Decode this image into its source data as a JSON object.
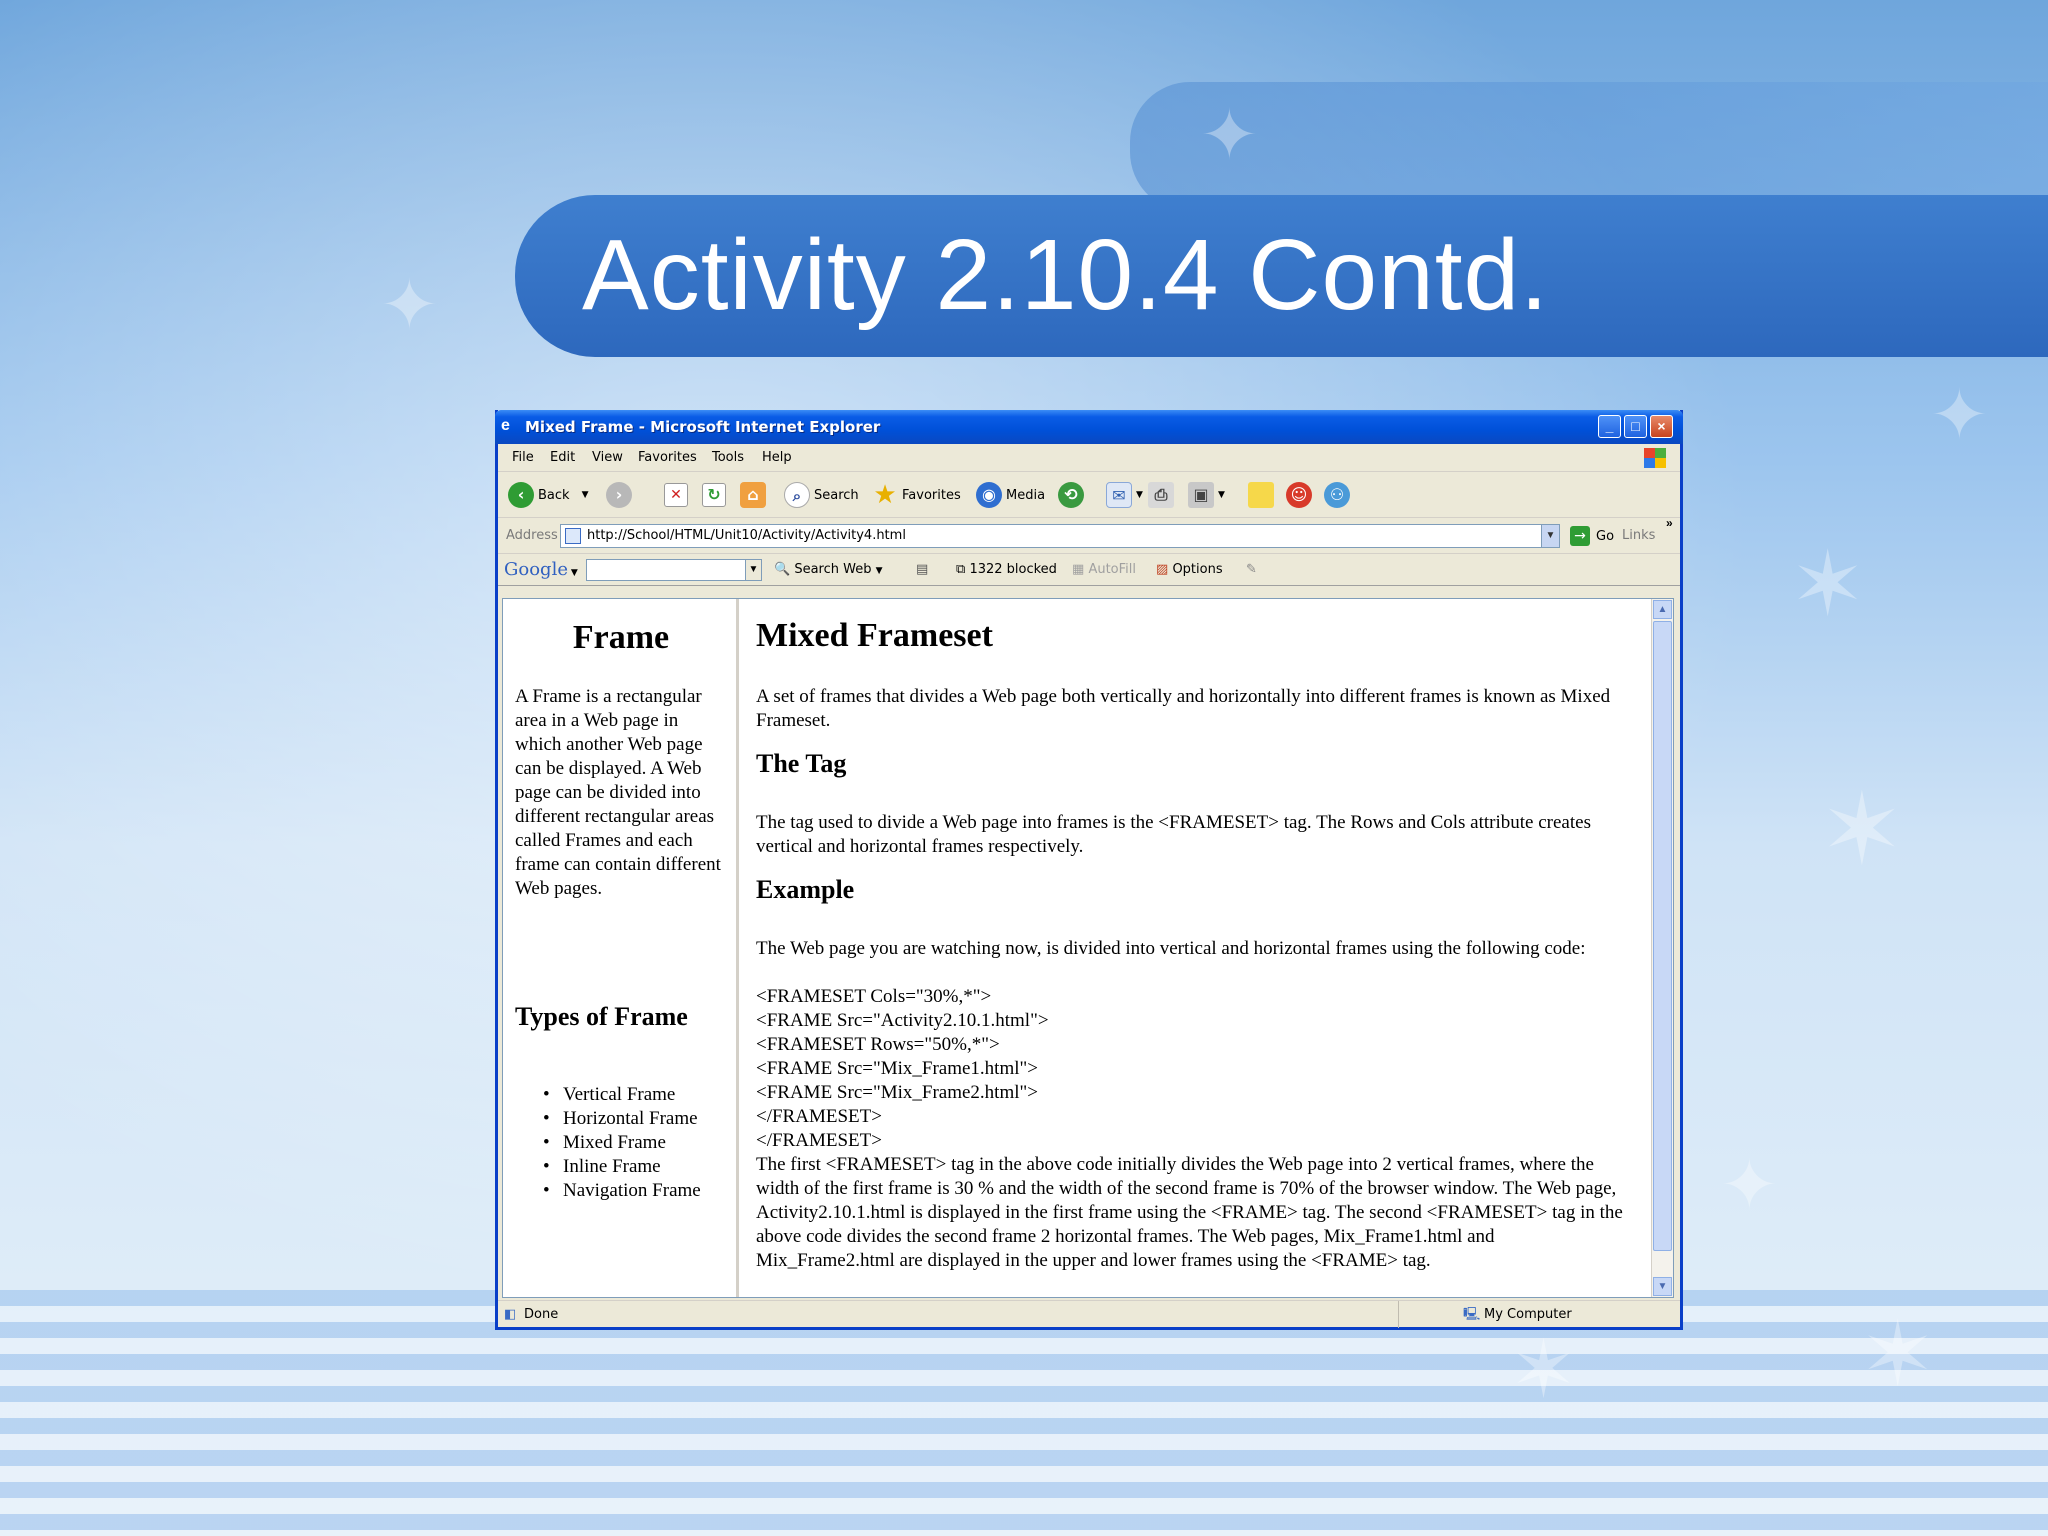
{
  "slide": {
    "title": "Activity 2.10.4 Contd."
  },
  "window": {
    "title": "Mixed Frame - Microsoft Internet Explorer",
    "controls": {
      "minimize": "_",
      "maximize": "□",
      "close": "×"
    }
  },
  "menu": [
    "File",
    "Edit",
    "View",
    "Favorites",
    "Tools",
    "Help"
  ],
  "toolbar": {
    "back": "Back",
    "search": "Search",
    "favorites": "Favorites",
    "media": "Media"
  },
  "address": {
    "label": "Address",
    "url": "http://School/HTML/Unit10/Activity/Activity4.html",
    "go": "Go",
    "links": "Links"
  },
  "google_bar": {
    "logo": "Google",
    "search_web": "Search Web",
    "blocked": "1322 blocked",
    "autofill": "AutoFill",
    "options": "Options"
  },
  "left_frame": {
    "heading": "Frame",
    "paragraph": "A Frame is a rectangular area in a Web page in which another Web page can be displayed. A Web page can be divided into different rectangular areas called Frames and each frame can contain different Web pages.",
    "types_heading": "Types of Frame",
    "types": [
      "Vertical Frame",
      "Horizontal Frame",
      "Mixed Frame",
      "Inline Frame",
      "Navigation Frame"
    ]
  },
  "right_frame": {
    "heading": "Mixed Frameset",
    "intro": "A set of frames that divides a Web page both vertically and horizontally into different frames is known as Mixed Frameset.",
    "tag_heading": "The Tag",
    "tag_text": "The tag used to divide a Web page into frames is the <FRAMESET> tag. The Rows and Cols attribute creates vertical and horizontal frames respectively.",
    "example_heading": "Example",
    "example_intro": "The Web page you are watching now, is divided into vertical and horizontal frames using the following code:",
    "code_lines": [
      "<FRAMESET Cols=\"30%,*\">",
      "<FRAME Src=\"Activity2.10.1.html\">",
      "<FRAMESET Rows=\"50%,*\">",
      "<FRAME Src=\"Mix_Frame1.html\">",
      "<FRAME Src=\"Mix_Frame2.html\">",
      "</FRAMESET>",
      "</FRAMESET>"
    ],
    "explanation": "The first <FRAMESET> tag in the above code initially divides the Web page into 2 vertical frames, where the width of the first frame is 30 % and the width of the second frame is 70% of the browser window. The Web page, Activity2.10.1.html is displayed in the first frame using the <FRAME> tag. The second <FRAMESET> tag in the above code divides the second frame 2 horizontal frames. The Web pages, Mix_Frame1.html and Mix_Frame2.html are displayed in the upper and lower frames using the <FRAME> tag."
  },
  "status": {
    "left": "Done",
    "zone": "My Computer"
  }
}
